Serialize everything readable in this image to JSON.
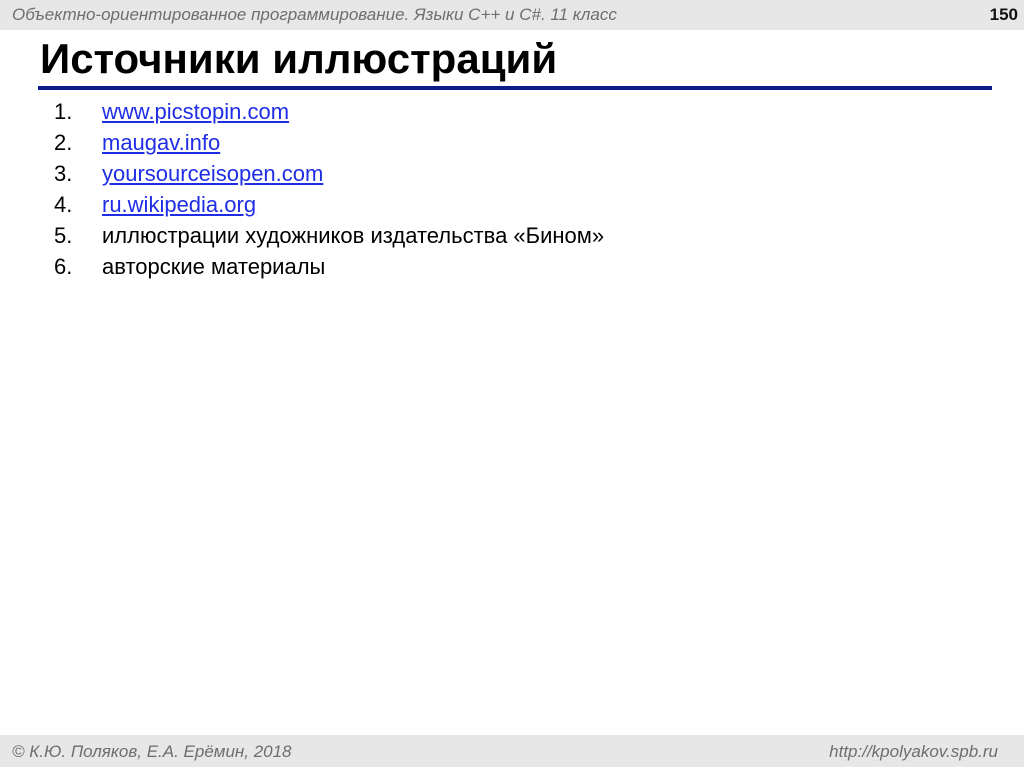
{
  "header": {
    "course_title": "Объектно-ориентированное программирование. Языки С++ и С#. 11 класс",
    "slide_number": "150"
  },
  "slide": {
    "title": "Источники иллюстраций",
    "items": [
      {
        "number": "1.",
        "text": "www.picstopin.com"
      },
      {
        "number": "2.",
        "text": "maugav.info"
      },
      {
        "number": "3.",
        "text": "yoursourceisopen.com"
      },
      {
        "number": "4.",
        "text": "ru.wikipedia.org"
      },
      {
        "number": "5.",
        "text": "иллюстрации художников издательства «Бином»"
      },
      {
        "number": "6.",
        "text": "авторские материалы"
      }
    ]
  },
  "footer": {
    "copyright": "© К.Ю. Поляков, Е.А. Ерёмин, 2018",
    "url": "http://kpolyakov.spb.ru"
  },
  "colors": {
    "link": "#1f2ee6",
    "title_rule": "#0d1c8c",
    "bar_background": "#e7e7e7"
  }
}
